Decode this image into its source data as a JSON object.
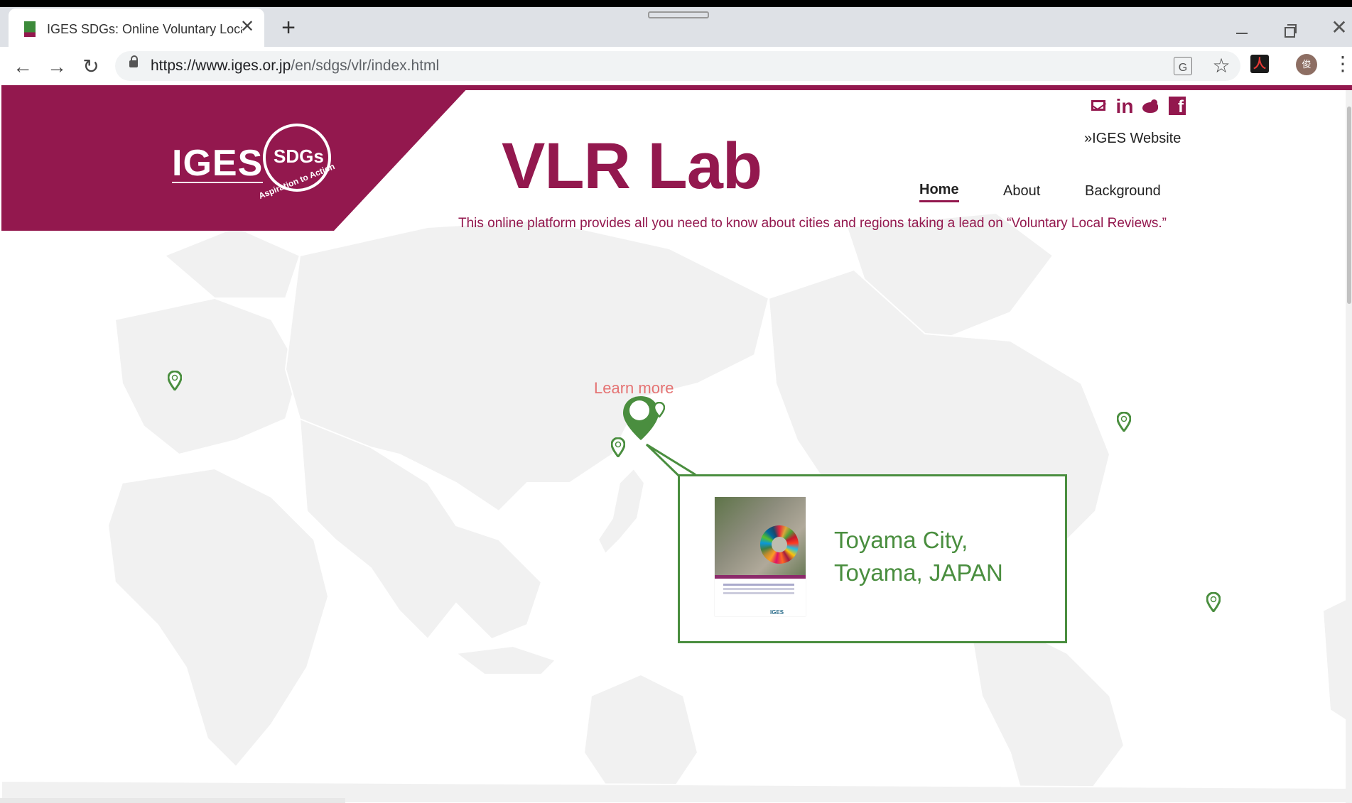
{
  "browser": {
    "tab_title": "IGES SDGs: Online Voluntary Local Reviews Lab",
    "tab_close": "✕",
    "new_tab": "+",
    "url_host": "https://www.iges.or.jp",
    "url_path": "/en/sdgs/vlr/index.html",
    "avatar_initial": "俊",
    "pdf_icon_glyph": "人"
  },
  "header": {
    "logo_text": "IGES",
    "logo_badge": "SDGs",
    "logo_tagline": "Aspiration to Action",
    "site_title": "VLR Lab",
    "iges_website_link": "»IGES Website",
    "linkedin_glyph": "in",
    "tagline": "This online platform provides all you need to know about cities and regions taking a lead on “Voluntary Local Reviews.”"
  },
  "nav": {
    "items": [
      {
        "label": "Home",
        "active": true
      },
      {
        "label": "About",
        "active": false
      },
      {
        "label": "Background",
        "active": false
      }
    ]
  },
  "map": {
    "learn_more": "Learn more",
    "pins": [
      {
        "name": "pin-europe"
      },
      {
        "name": "pin-japan-selected",
        "selected": true
      },
      {
        "name": "pin-japan-north"
      },
      {
        "name": "pin-korea"
      },
      {
        "name": "pin-usa-east"
      },
      {
        "name": "pin-brazil"
      }
    ]
  },
  "popup": {
    "city_line1": "Toyama City,",
    "city_line2": "Toyama, JAPAN",
    "thumb_logo": "IGES"
  },
  "colors": {
    "brand": "#93184e",
    "pin": "#4a8e3f",
    "learn_more": "#e57373",
    "land": "#f1f1f1"
  }
}
